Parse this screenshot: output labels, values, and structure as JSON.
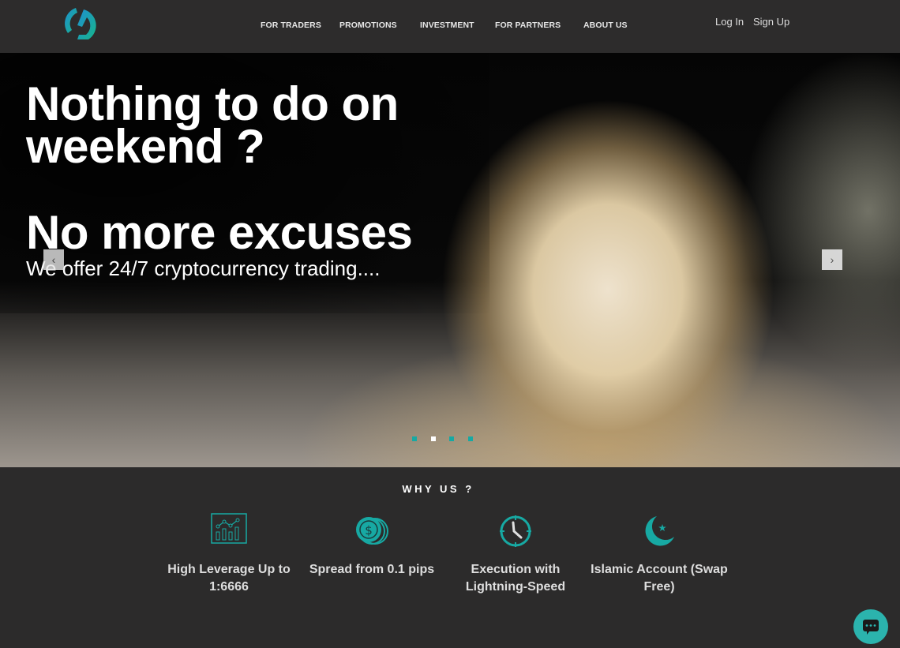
{
  "header": {
    "logo": "brand-logo",
    "nav": [
      {
        "label": "FOR TRADERS"
      },
      {
        "label": "PROMOTIONS"
      },
      {
        "label": "INVESTMENT"
      },
      {
        "label": "FOR PARTNERS"
      },
      {
        "label": "ABOUT US"
      }
    ],
    "login_label": "Log In",
    "signup_label": "Sign Up"
  },
  "hero": {
    "headline_1": "Nothing to do on weekend ?",
    "headline_2": "No more excuses",
    "subtitle": "We offer 24/7 cryptocurrency trading....",
    "prev_label": "‹",
    "next_label": "›",
    "slides_count": 4,
    "active_slide": 2
  },
  "why": {
    "title": "WHY US ?",
    "features": [
      {
        "icon": "chart-icon",
        "label": "High Leverage Up to 1:6666"
      },
      {
        "icon": "coins-icon",
        "label": "Spread from 0.1 pips"
      },
      {
        "icon": "clock-icon",
        "label": "Execution with Lightning-Speed"
      },
      {
        "icon": "crescent-icon",
        "label": "Islamic Account (Swap Free)"
      }
    ]
  },
  "colors": {
    "accent": "#17a9a3",
    "header_bg": "#2d2c2c",
    "section_bg": "#2c2b2b"
  },
  "chat": {
    "icon": "chat-icon"
  }
}
